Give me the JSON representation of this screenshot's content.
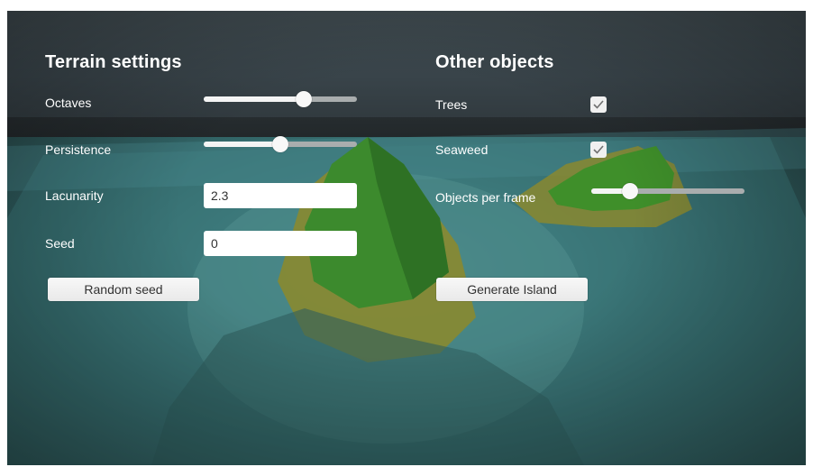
{
  "terrain": {
    "heading": "Terrain settings",
    "octaves": {
      "label": "Octaves",
      "value": 0.65
    },
    "persistence": {
      "label": "Persistence",
      "value": 0.5
    },
    "lacunarity": {
      "label": "Lacunarity",
      "value": "2.3"
    },
    "seed": {
      "label": "Seed",
      "value": "0"
    },
    "random_seed_label": "Random seed"
  },
  "objects": {
    "heading": "Other objects",
    "trees": {
      "label": "Trees",
      "checked": true
    },
    "seaweed": {
      "label": "Seaweed",
      "checked": true
    },
    "objects_per_frame": {
      "label": "Objects per frame",
      "value": 0.25
    },
    "generate_label": "Generate Island"
  },
  "colors": {
    "water": "#3f7d7f",
    "grass": "#3f8f2a",
    "sand": "#9a8f2a",
    "ui_text": "#ffffff"
  }
}
